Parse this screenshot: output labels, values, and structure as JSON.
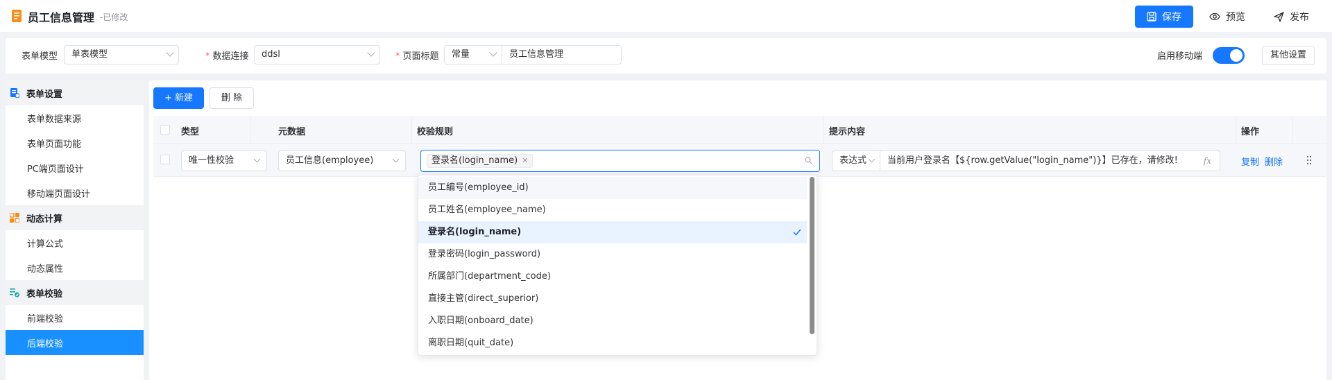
{
  "header": {
    "title": "员工信息管理",
    "status": "-已修改",
    "save_label": "保存",
    "preview_label": "预览",
    "publish_label": "发布"
  },
  "settings": {
    "form_model_label": "表单模型",
    "form_model_value": "单表模型",
    "data_conn_label": "数据连接",
    "data_conn_value": "ddsl",
    "page_title_label": "页面标题",
    "page_title_mode": "常量",
    "page_title_value": "员工信息管理",
    "mobile_label": "启用移动端",
    "mobile_enabled": true,
    "other_settings_label": "其他设置"
  },
  "sidebar": {
    "groups": [
      {
        "label": "表单设置",
        "icon": "form-settings-icon",
        "color": "#1677ff",
        "items": [
          "表单数据来源",
          "表单页面功能",
          "PC端页面设计",
          "移动端页面设计"
        ]
      },
      {
        "label": "动态计算",
        "icon": "grid-calc-icon",
        "color": "#fa8c16",
        "items": [
          "计算公式",
          "动态属性"
        ]
      },
      {
        "label": "表单校验",
        "icon": "form-check-icon",
        "color": "#13a8a8",
        "items": [
          "前端校验",
          "后端校验"
        ]
      }
    ],
    "active_item": "后端校验"
  },
  "toolbar": {
    "new_label": "+ 新建",
    "delete_label": "删 除"
  },
  "table": {
    "columns": [
      "类型",
      "元数据",
      "校验规则",
      "提示内容",
      "操作"
    ],
    "row": {
      "type": "唯一性校验",
      "metadata": "员工信息(employee)",
      "rule_tag": "登录名(login_name)",
      "hint_mode": "表达式",
      "hint_text": "当前用户登录名【${row.getValue(\"login_name\")}】已存在，请修改!",
      "fx_label": "fx",
      "copy_label": "复制",
      "delete_label": "删除"
    }
  },
  "dropdown": {
    "options": [
      "员工编号(employee_id)",
      "员工姓名(employee_name)",
      "登录名(login_name)",
      "登录密码(login_password)",
      "所属部门(department_code)",
      "直接主管(direct_superior)",
      "入职日期(onboard_date)",
      "离职日期(quit_date)"
    ],
    "selected": "登录名(login_name)",
    "hovered": "员工编号(employee_id)"
  },
  "colors": {
    "primary": "#1677ff",
    "active_sidebar": "#1890ff"
  }
}
